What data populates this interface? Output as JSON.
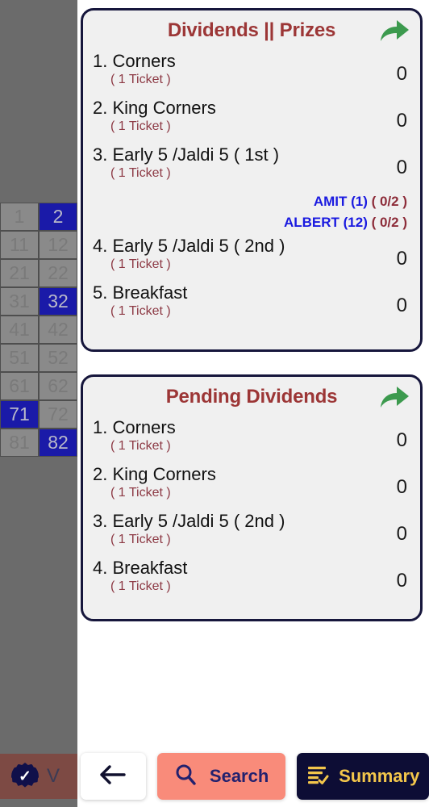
{
  "background": {
    "grid_rows": [
      {
        "cells": [
          {
            "num": "1",
            "highlighted": false
          },
          {
            "num": "2",
            "highlighted": true
          }
        ]
      },
      {
        "cells": [
          {
            "num": "11",
            "highlighted": false
          },
          {
            "num": "12",
            "highlighted": false
          }
        ]
      },
      {
        "cells": [
          {
            "num": "21",
            "highlighted": false
          },
          {
            "num": "22",
            "highlighted": false
          }
        ]
      },
      {
        "cells": [
          {
            "num": "31",
            "highlighted": false
          },
          {
            "num": "32",
            "highlighted": true
          }
        ]
      },
      {
        "cells": [
          {
            "num": "41",
            "highlighted": false
          },
          {
            "num": "42",
            "highlighted": false
          }
        ]
      },
      {
        "cells": [
          {
            "num": "51",
            "highlighted": false
          },
          {
            "num": "52",
            "highlighted": false
          }
        ]
      },
      {
        "cells": [
          {
            "num": "61",
            "highlighted": false
          },
          {
            "num": "62",
            "highlighted": false
          }
        ]
      },
      {
        "cells": [
          {
            "num": "71",
            "highlighted": true
          },
          {
            "num": "72",
            "highlighted": false
          }
        ]
      },
      {
        "cells": [
          {
            "num": "81",
            "highlighted": false
          },
          {
            "num": "82",
            "highlighted": true
          }
        ]
      }
    ],
    "bottom_button": {
      "badge_icon": "verified-check-icon",
      "label": "V"
    }
  },
  "dividends_card": {
    "title": "Dividends || Prizes",
    "share_icon": "share-arrow-icon",
    "rows": [
      {
        "name": "1. Corners",
        "sub": "( 1 Ticket )",
        "value": "0"
      },
      {
        "name": "2. King Corners",
        "sub": "( 1 Ticket )",
        "value": "0"
      },
      {
        "name": "3. Early 5 /Jaldi 5 ( 1st )",
        "sub": "( 1 Ticket )",
        "value": "0"
      },
      {
        "name": "4. Early 5 /Jaldi 5 ( 2nd )",
        "sub": "( 1 Ticket )",
        "value": "0"
      },
      {
        "name": "5. Breakfast",
        "sub": "( 1 Ticket )",
        "value": "0"
      }
    ],
    "winners": [
      {
        "name": "AMIT (1)",
        "score": "( 0/2 )"
      },
      {
        "name": "ALBERT (12)",
        "score": "( 0/2 )"
      }
    ]
  },
  "pending_card": {
    "title": "Pending Dividends",
    "share_icon": "share-arrow-icon",
    "rows": [
      {
        "name": "1. Corners",
        "sub": "( 1 Ticket )",
        "value": "0"
      },
      {
        "name": "2. King Corners",
        "sub": "( 1 Ticket )",
        "value": "0"
      },
      {
        "name": "3. Early 5 /Jaldi 5 ( 2nd )",
        "sub": "( 1 Ticket )",
        "value": "0"
      },
      {
        "name": "4. Breakfast",
        "sub": "( 1 Ticket )",
        "value": "0"
      }
    ]
  },
  "bottom_bar": {
    "back_icon": "arrow-left-icon",
    "search": {
      "icon": "magnifier-icon",
      "label": "Search"
    },
    "summary": {
      "icon": "checklist-icon",
      "label": "Summary"
    }
  },
  "colors": {
    "card_border": "#16163c",
    "card_bg": "#f0f0f0",
    "title_red": "#9c3636",
    "ticket_red": "#8d3a45",
    "winner_blue": "#1a1ae0",
    "winner_score_red": "#8d2d3a",
    "share_green": "#3c9a4e",
    "search_bg": "#f98b7a",
    "search_text": "#23216e",
    "summary_bg": "#0d0d35",
    "summary_text": "#f3c64b",
    "grid_highlight": "#1a1aa8"
  }
}
